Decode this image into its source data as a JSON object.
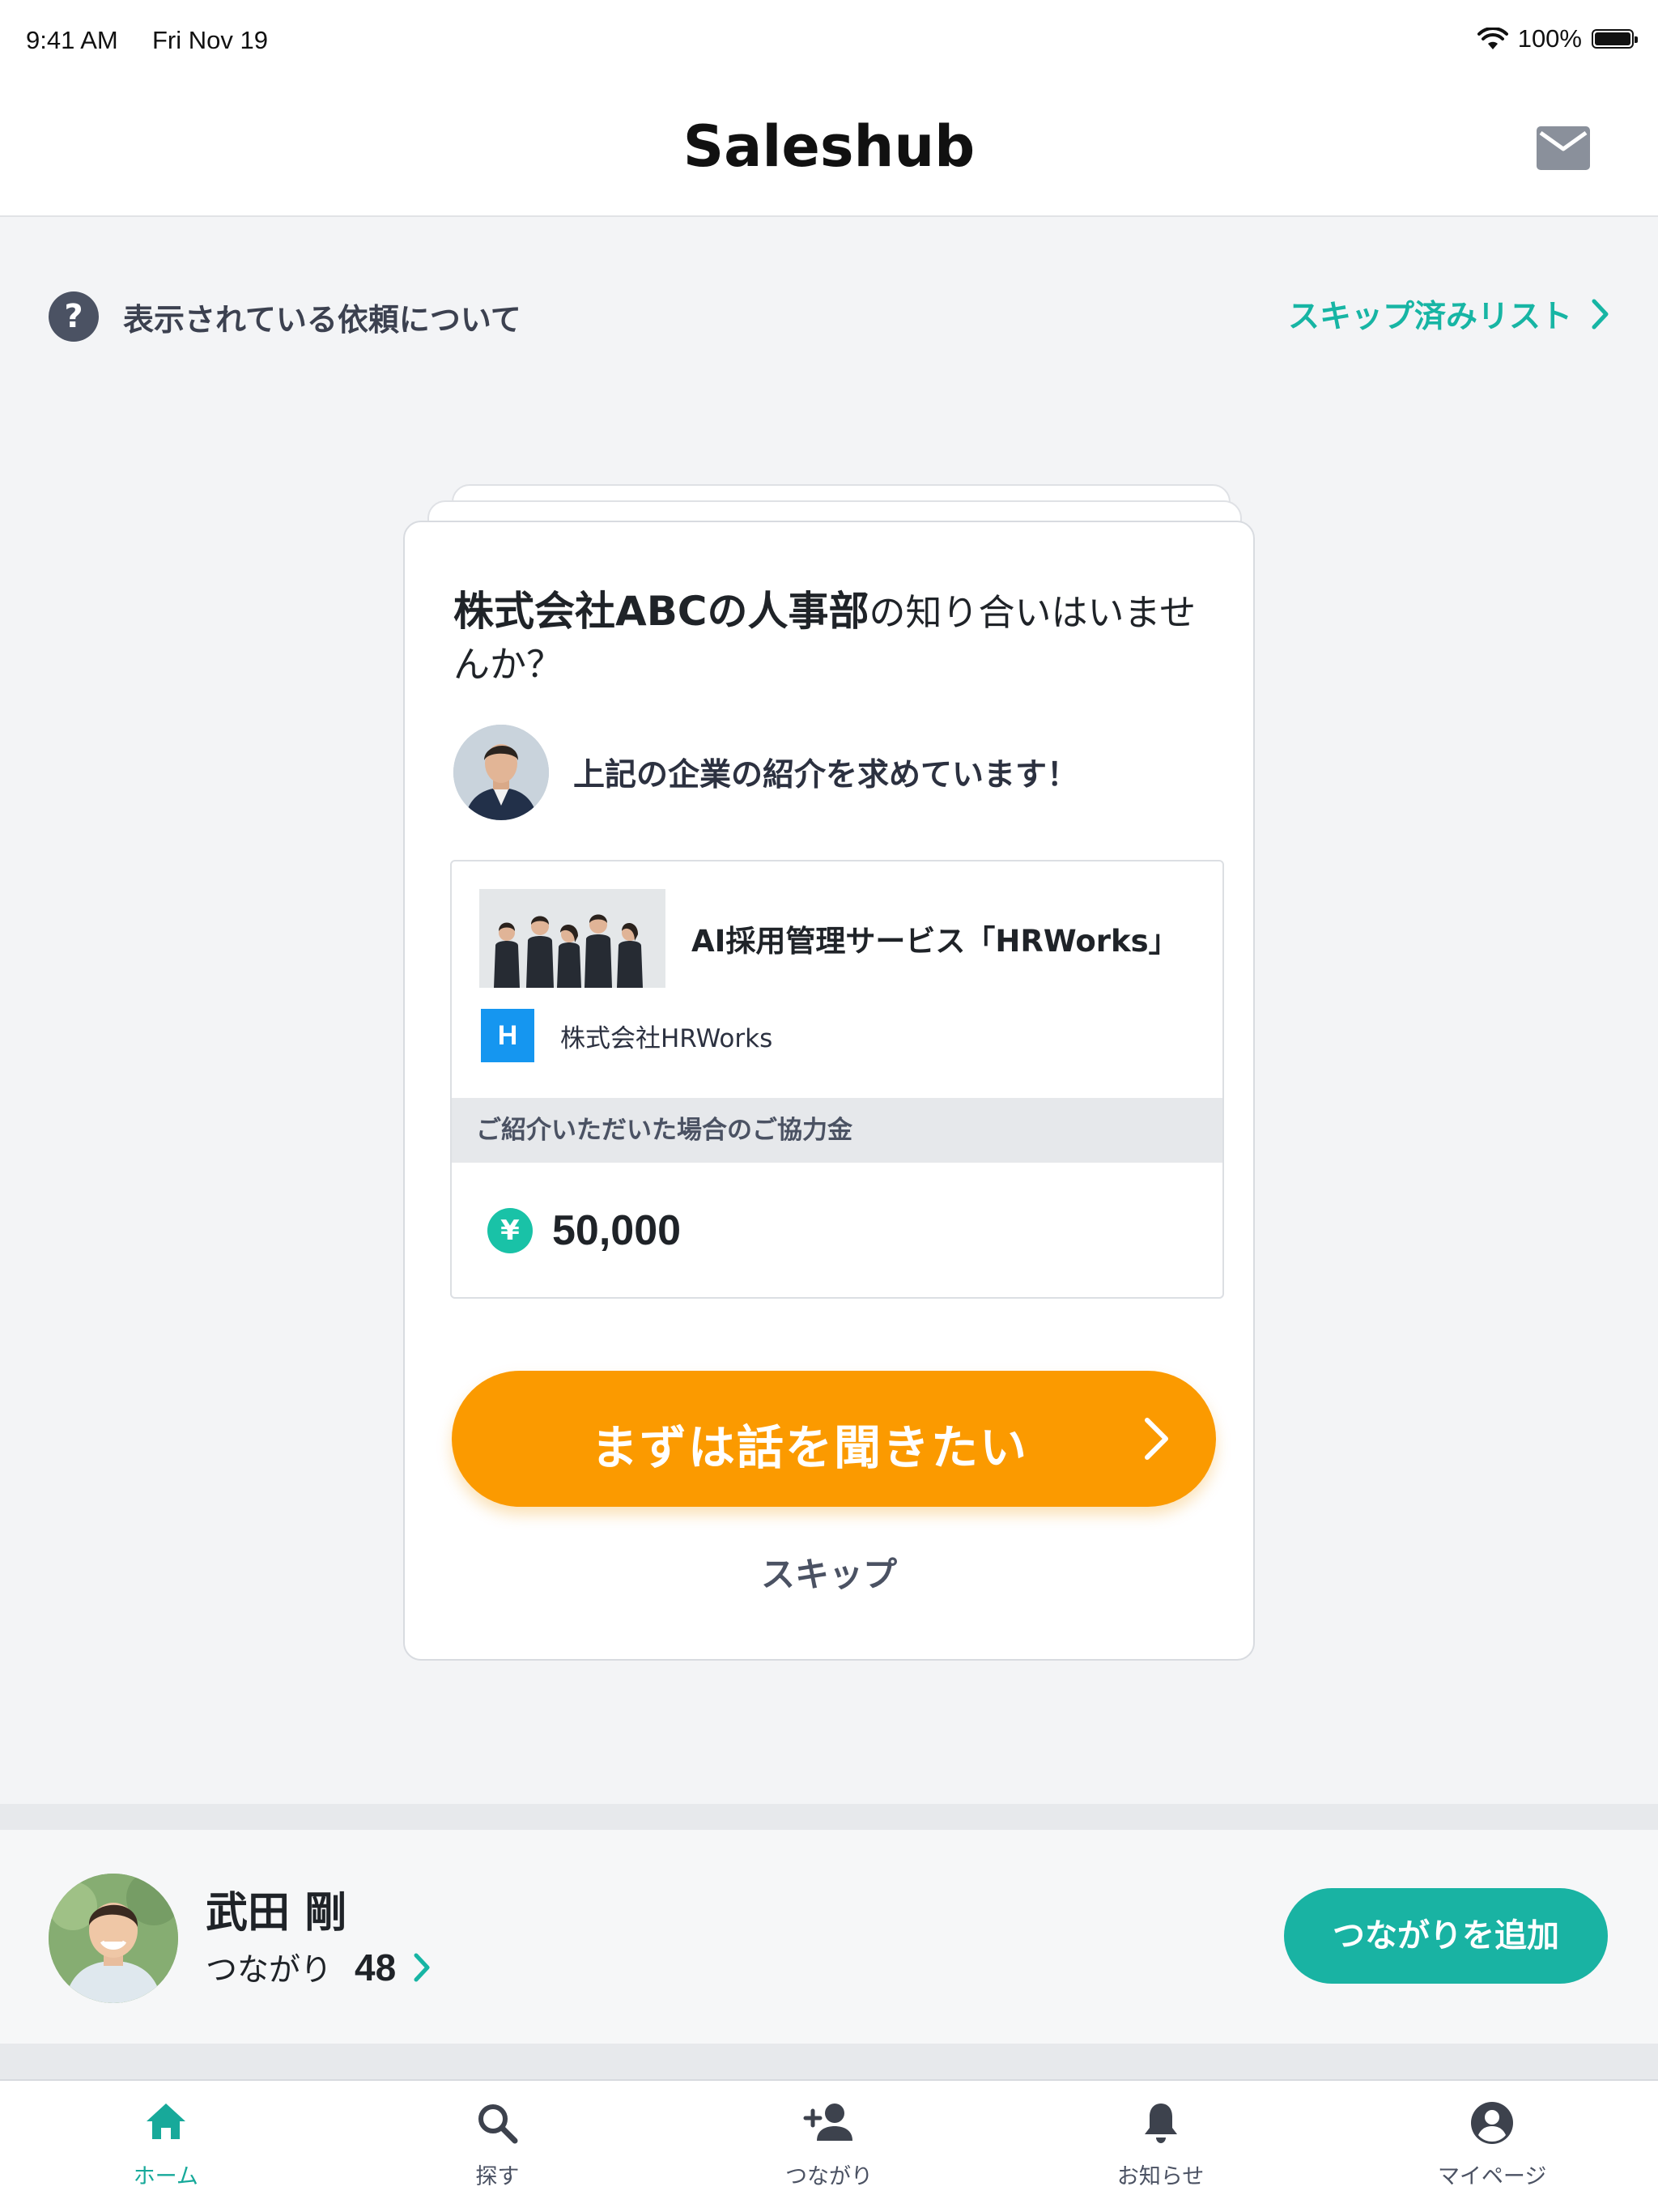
{
  "status_bar": {
    "time": "9:41 AM",
    "date": "Fri Nov 19",
    "battery": "100%"
  },
  "header": {
    "title": "Saleshub",
    "mail_icon": "mail-icon"
  },
  "info_bar": {
    "help_icon": "?",
    "label": "表示されている依頼について",
    "skip_list_label": "スキップ済みリスト"
  },
  "request_card": {
    "question_strong": "株式会社ABCの人事部",
    "question_rest": "の知り合いはいませんか？",
    "requester_message": "上記の企業の紹介を求めています！",
    "service": {
      "name": "AI採用管理サービス「HRWorks」",
      "company_logo_letter": "H",
      "company_name": "株式会社HRWorks"
    },
    "reward": {
      "label": "ご紹介いただいた場合のご協力金",
      "currency_symbol": "¥",
      "amount": "50,000"
    },
    "primary_action": "まずは話を聞きたい",
    "skip_label": "スキップ"
  },
  "profile": {
    "name": "武田 剛",
    "connections_label": "つながり",
    "connections_count": "48",
    "add_connection_label": "つながりを追加"
  },
  "tab_bar": {
    "tabs": [
      {
        "label": "ホーム",
        "icon": "home-icon",
        "active": true
      },
      {
        "label": "探す",
        "icon": "search-icon",
        "active": false
      },
      {
        "label": "つながり",
        "icon": "person-add-icon",
        "active": false
      },
      {
        "label": "お知らせ",
        "icon": "bell-icon",
        "active": false
      },
      {
        "label": "マイページ",
        "icon": "account-icon",
        "active": false
      }
    ]
  },
  "colors": {
    "accent_teal": "#17b5a4",
    "cta_orange": "#fb9a00",
    "logo_blue": "#1596f0"
  }
}
